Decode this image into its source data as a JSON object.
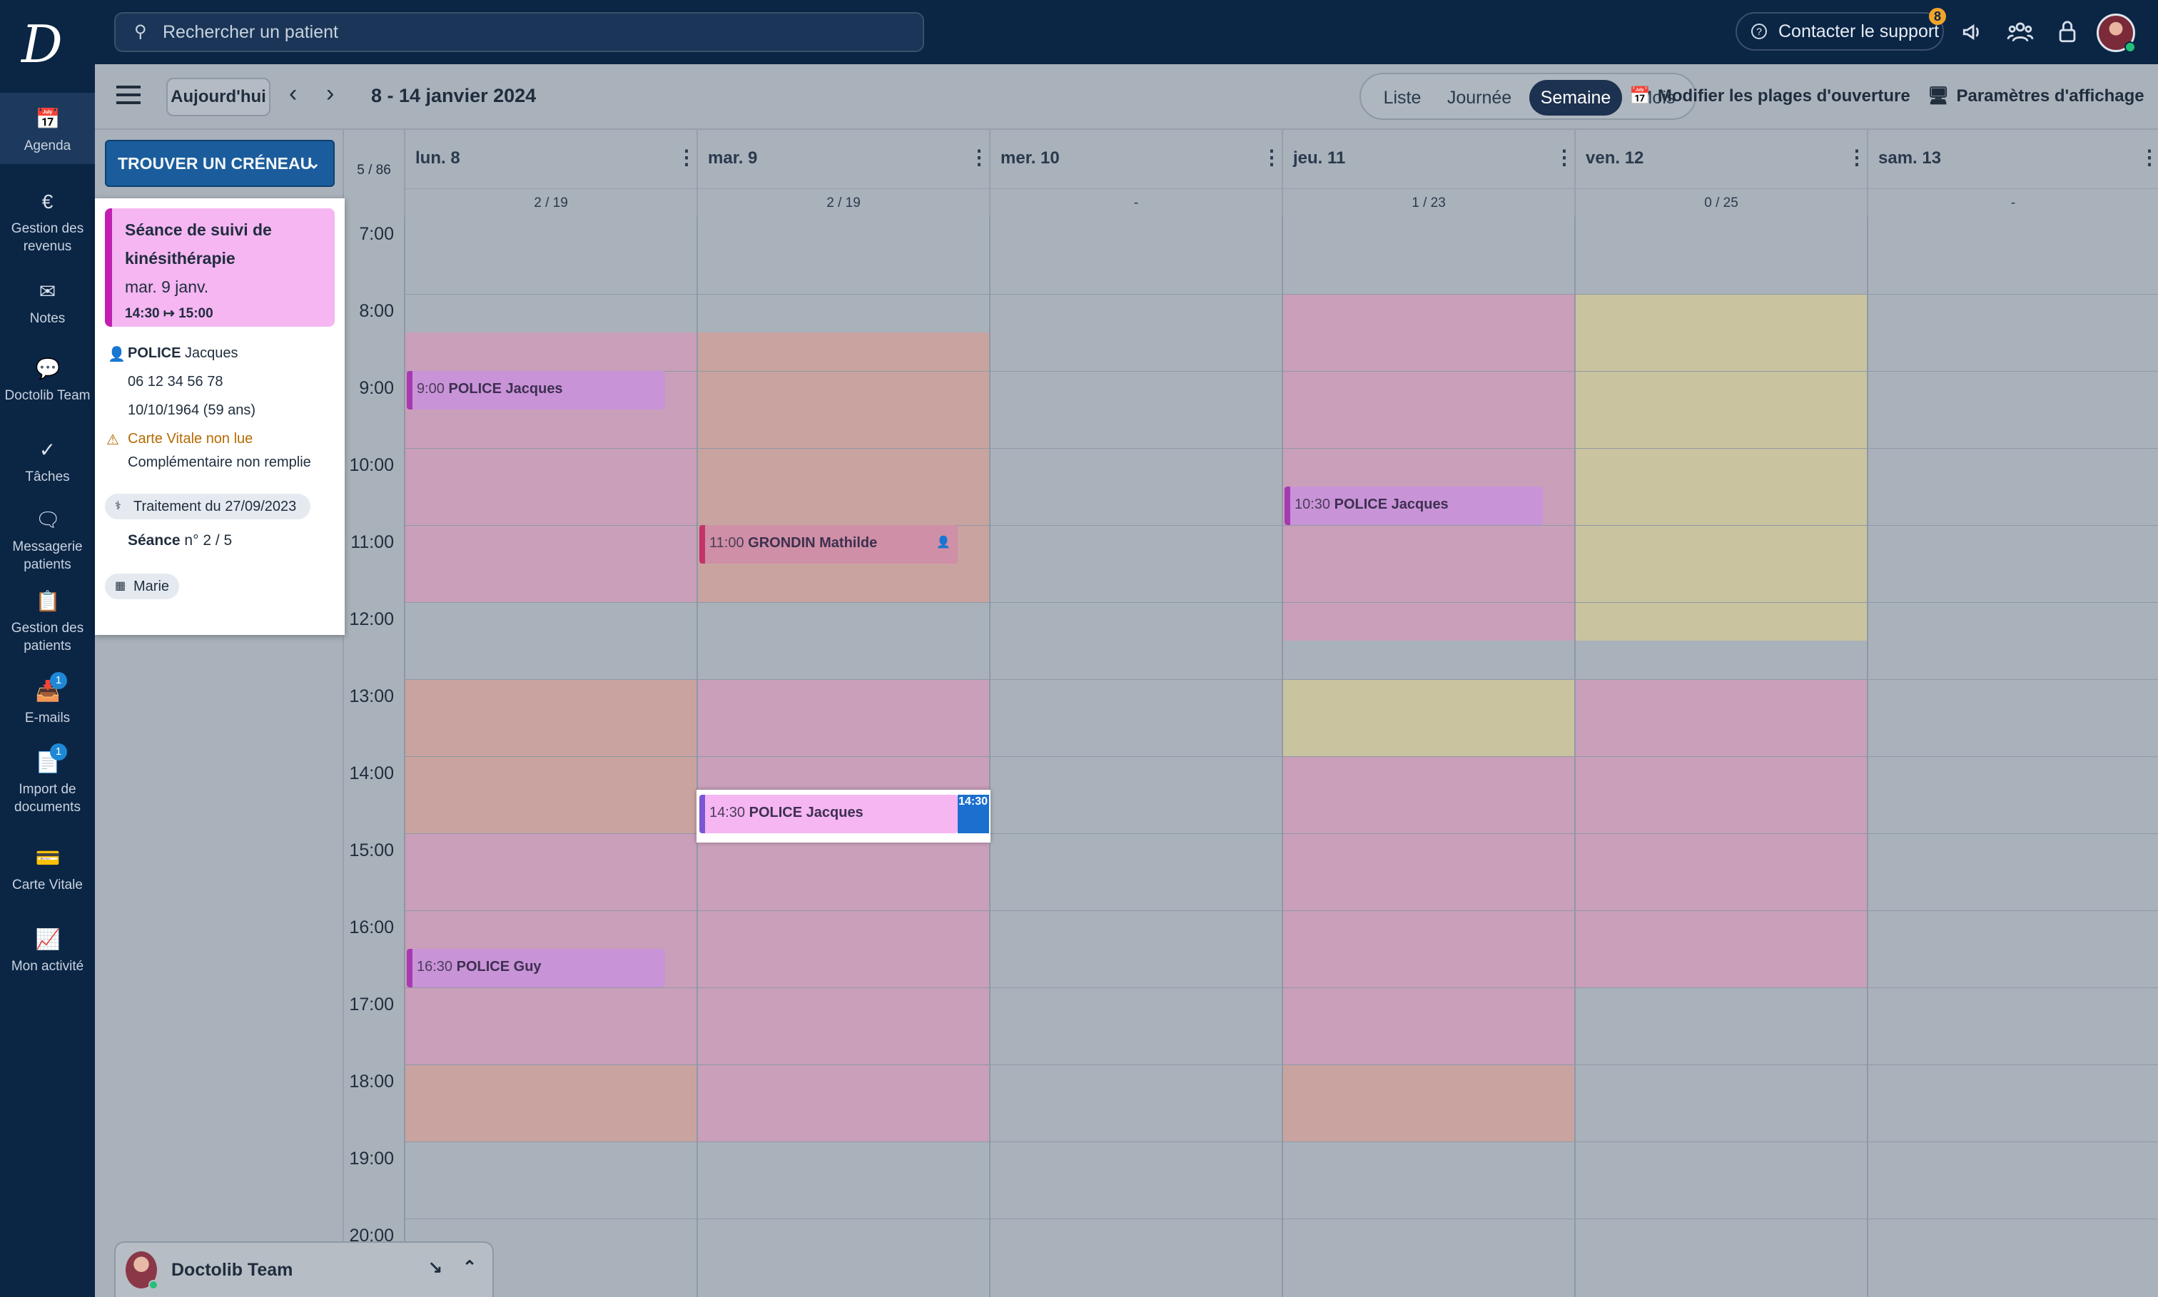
{
  "topbar": {
    "logo": "D",
    "search_placeholder": "Rechercher un patient",
    "support_label": "Contacter le support",
    "support_badge": "8",
    "icons": [
      "megaphone-icon",
      "team-icon",
      "lock-icon"
    ]
  },
  "sidebar": {
    "items": [
      {
        "label": "Agenda",
        "icon": "calendar-icon",
        "active": true
      },
      {
        "label": "Gestion des revenus",
        "icon": "euro-icon"
      },
      {
        "label": "Notes",
        "icon": "mail-icon"
      },
      {
        "label": "Doctolib Team",
        "icon": "chat-icon"
      },
      {
        "label": "Tâches",
        "icon": "check-icon"
      },
      {
        "label": "Messagerie patients",
        "icon": "message-icon"
      },
      {
        "label": "Gestion des patients",
        "icon": "clipboard-icon"
      },
      {
        "label": "E-mails",
        "icon": "inbox-icon",
        "badge": "1"
      },
      {
        "label": "Import de documents",
        "icon": "document-icon",
        "badge": "1"
      },
      {
        "label": "Carte Vitale",
        "icon": "card-icon"
      },
      {
        "label": "Mon activité",
        "icon": "chart-icon"
      }
    ]
  },
  "toolbar": {
    "today": "Aujourd'hui",
    "range": "8 - 14 janvier 2024",
    "views": [
      "Liste",
      "Journée",
      "Semaine",
      "Mois"
    ],
    "active_view": "Semaine",
    "opening_hours": "Modifier les plages d'ouverture",
    "display_settings": "Paramètres d'affichage"
  },
  "leftpanel": {
    "find_slot": "TROUVER UN CRÉNEAU"
  },
  "popup": {
    "title_line1": "Séance de suivi de",
    "title_line2": "kinésithérapie",
    "date": "mar. 9 janv.",
    "time": "14:30 ↦ 15:00",
    "patient_last": "POLICE",
    "patient_first": "Jacques",
    "phone": "06 12 34 56 78",
    "dob": "10/10/1964 (59 ans)",
    "warning": "Carte Vitale non lue",
    "complementary": "Complémentaire non remplie",
    "treatment": "Traitement du 27/09/2023",
    "session_label": "Séance",
    "session_value": "n° 2 / 5",
    "agenda": "Marie",
    "colors": {
      "header": "#f5b6f2",
      "accent": "#c21fb0",
      "warning": "#b36b00"
    }
  },
  "calendar": {
    "week_count": "5 / 86",
    "days": [
      {
        "label": "lun. 8",
        "count": "2 / 19"
      },
      {
        "label": "mar. 9",
        "count": "2 / 19"
      },
      {
        "label": "mer. 10",
        "count": "-"
      },
      {
        "label": "jeu. 11",
        "count": "1 / 23"
      },
      {
        "label": "ven. 12",
        "count": "0 / 25"
      },
      {
        "label": "sam. 13",
        "count": "-"
      }
    ],
    "hours": [
      "7:00",
      "8:00",
      "9:00",
      "10:00",
      "11:00",
      "12:00",
      "13:00",
      "14:00",
      "15:00",
      "16:00",
      "17:00",
      "18:00",
      "19:00",
      "20:00"
    ],
    "appointments": [
      {
        "time": "9:00",
        "name": "POLICE Jacques"
      },
      {
        "time": "11:00",
        "name": "GRONDIN Mathilde"
      },
      {
        "time": "10:30",
        "name": "POLICE Jacques"
      },
      {
        "time": "14:30",
        "name": "POLICE Jacques"
      },
      {
        "time": "16:30",
        "name": "POLICE Guy"
      }
    ],
    "current_time_tag": "14:30"
  },
  "team_widget": {
    "label": "Doctolib Team"
  }
}
